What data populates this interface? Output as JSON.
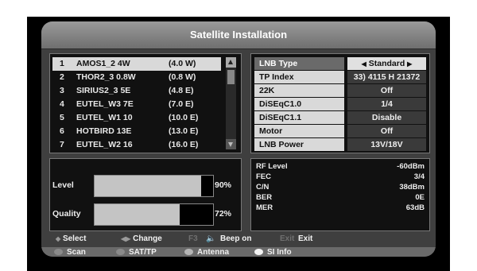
{
  "window": {
    "title": "Satellite Installation"
  },
  "satellites": [
    {
      "num": "1",
      "name": "AMOS1_2 4W",
      "pos": "(4.0 W)",
      "selected": true
    },
    {
      "num": "2",
      "name": "THOR2_3 0.8W",
      "pos": "(0.8 W)"
    },
    {
      "num": "3",
      "name": "SIRIUS2_3 5E",
      "pos": "(4.8 E)"
    },
    {
      "num": "4",
      "name": "EUTEL_W3 7E",
      "pos": "(7.0 E)"
    },
    {
      "num": "5",
      "name": "EUTEL_W1 10",
      "pos": "(10.0 E)"
    },
    {
      "num": "6",
      "name": "HOTBIRD 13E",
      "pos": "(13.0 E)"
    },
    {
      "num": "7",
      "name": "EUTEL_W2 16",
      "pos": "(16.0 E)"
    }
  ],
  "settings": [
    {
      "label": "LNB Type",
      "value": "Standard",
      "selected": true
    },
    {
      "label": "TP Index",
      "value": "33) 4115 H 21372"
    },
    {
      "label": "22K",
      "value": "Off"
    },
    {
      "label": "DiSEqC1.0",
      "value": "1/4"
    },
    {
      "label": "DiSEqC1.1",
      "value": "Disable"
    },
    {
      "label": "Motor",
      "value": "Off"
    },
    {
      "label": "LNB Power",
      "value": "13V/18V"
    }
  ],
  "signal": {
    "level": {
      "label": "Level",
      "percent": "90%",
      "fraction": 0.9
    },
    "quality": {
      "label": "Quality",
      "percent": "72%",
      "fraction": 0.72
    }
  },
  "stats": [
    {
      "key": "RF Level",
      "value": "-60dBm"
    },
    {
      "key": "FEC",
      "value": "3/4"
    },
    {
      "key": "C/N",
      "value": "38dBm"
    },
    {
      "key": "BER",
      "value": "0E"
    },
    {
      "key": "MER",
      "value": "63dB"
    }
  ],
  "help": {
    "select": "Select",
    "change": "Change",
    "f3": "F3",
    "beep": "Beep on",
    "exit_key": "Exit",
    "exit": "Exit"
  },
  "colorbuttons": [
    {
      "label": "Scan",
      "color": "#8a8a8a"
    },
    {
      "label": "SAT/TP",
      "color": "#8a8a8a"
    },
    {
      "label": "Antenna",
      "color": "#b5b5b5"
    },
    {
      "label": "SI Info",
      "color": "#f2f2f2"
    }
  ]
}
